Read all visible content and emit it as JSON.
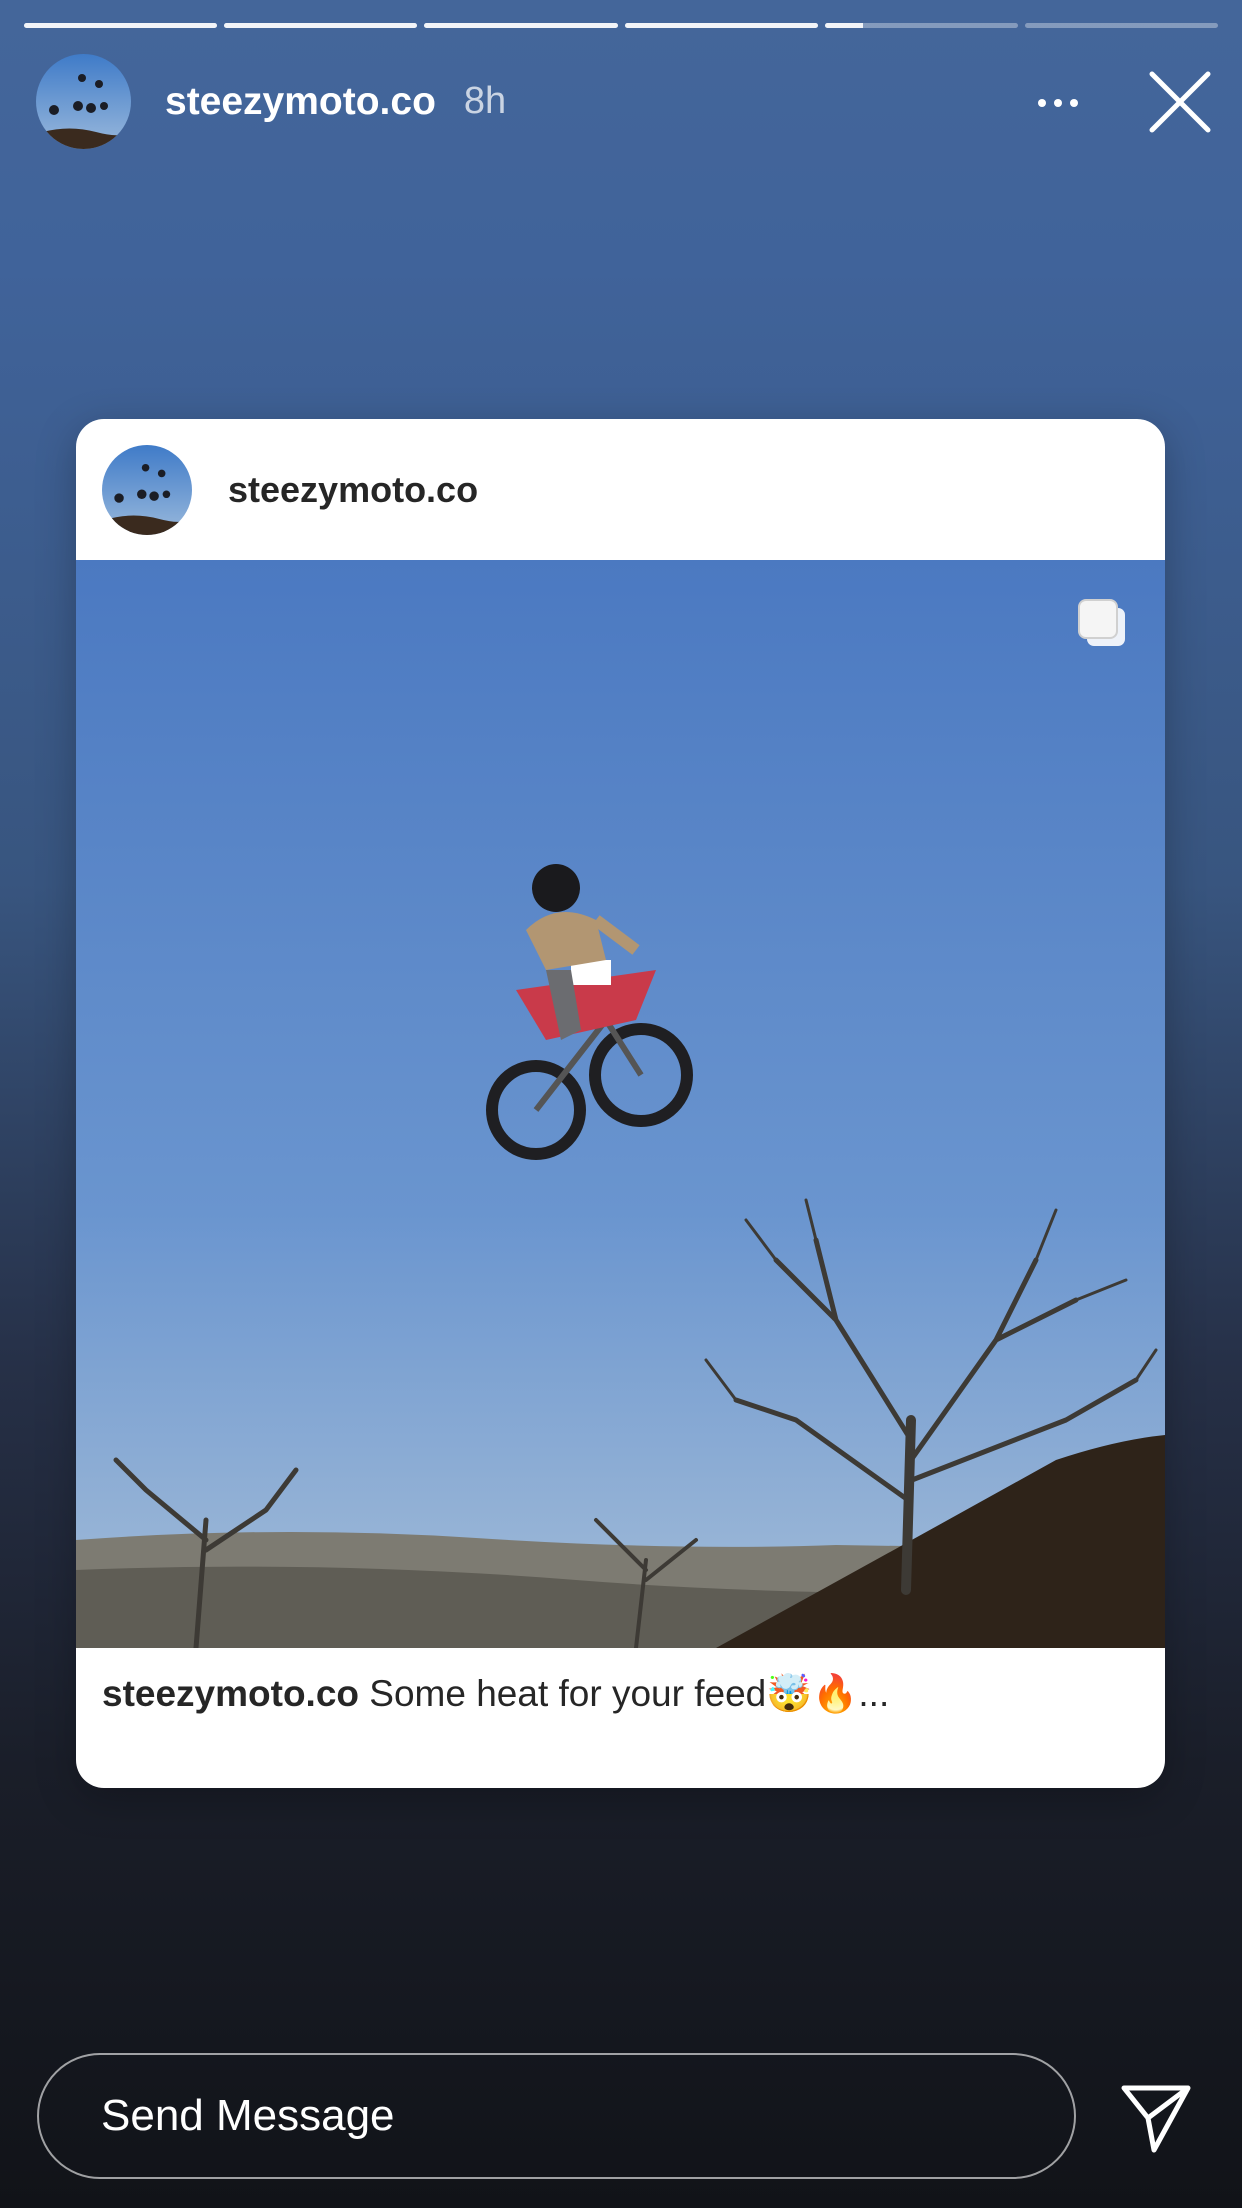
{
  "story": {
    "progress": [
      1,
      1,
      1,
      1,
      0.2,
      0
    ],
    "username": "steezymoto.co",
    "time": "8h"
  },
  "post": {
    "username": "steezymoto.co",
    "caption_user": "steezymoto.co",
    "caption_text": " Some heat for your feed🤯🔥..."
  },
  "composer": {
    "placeholder": "Send Message"
  },
  "icons": [
    "more-icon",
    "close-icon",
    "carousel-icon",
    "send-icon"
  ]
}
